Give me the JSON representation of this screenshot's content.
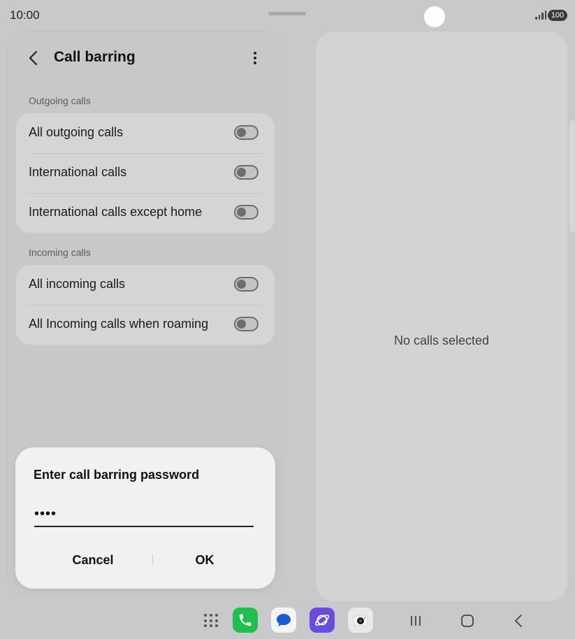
{
  "status_bar": {
    "time": "10:00",
    "battery": "100"
  },
  "header": {
    "title": "Call barring"
  },
  "sections": [
    {
      "label": "Outgoing calls",
      "items": [
        {
          "label": "All outgoing calls",
          "enabled": false
        },
        {
          "label": "International calls",
          "enabled": false
        },
        {
          "label": "International calls except home",
          "enabled": false
        }
      ]
    },
    {
      "label": "Incoming calls",
      "items": [
        {
          "label": "All incoming calls",
          "enabled": false
        },
        {
          "label": "All Incoming calls when roaming",
          "enabled": false
        }
      ]
    }
  ],
  "detail": {
    "empty_text": "No calls selected"
  },
  "dialog": {
    "title": "Enter call barring password",
    "password_value": "••••",
    "cancel_label": "Cancel",
    "ok_label": "OK"
  },
  "taskbar": {
    "apps": [
      "apps-grid-icon",
      "phone-app-icon",
      "messages-app-icon",
      "internet-app-icon",
      "camera-app-icon"
    ],
    "nav": [
      "recents-icon",
      "home-icon",
      "back-nav-icon"
    ]
  },
  "colors": {
    "background": "#c9c9cb",
    "card": "#d5d5d7",
    "dialog": "#f1f1f2",
    "phone_green": "#1fbf4f",
    "messages_blue": "#1a5bd8",
    "internet_purple": "#6a4be0"
  }
}
